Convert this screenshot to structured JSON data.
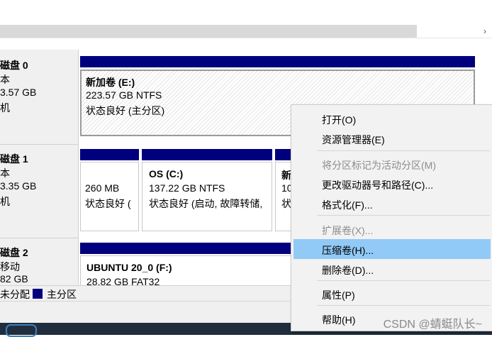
{
  "disks": [
    {
      "name": "磁盘 0",
      "type": "本",
      "size": "3.57 GB",
      "status": "机"
    },
    {
      "name": "磁盘 1",
      "type": "本",
      "size": "3.35 GB",
      "status": "机"
    },
    {
      "name": "磁盘 2",
      "type": "移动",
      "size": "82 GB"
    }
  ],
  "volumes": {
    "d0_e": {
      "title": "新加卷 (E:)",
      "size": "223.57 GB NTFS",
      "status": "状态良好 (主分区)"
    },
    "d1_p1": {
      "size": "260 MB",
      "status": "状态良好 ("
    },
    "d1_c": {
      "title": "OS  (C:)",
      "size": "137.22 GB NTFS",
      "status": "状态良好 (启动, 故障转储,"
    },
    "d1_p3": {
      "title": "新",
      "size": "10",
      "status": "状"
    },
    "d2_f": {
      "title": "UBUNTU 20_0  (F:)",
      "size": "28.82 GB FAT32"
    }
  },
  "legend": {
    "unallocated": "未分配",
    "primary": "主分区"
  },
  "context_menu": {
    "items": [
      {
        "label": "打开(O)",
        "enabled": true
      },
      {
        "label": "资源管理器(E)",
        "enabled": true
      },
      {
        "label": "将分区标记为活动分区(M)",
        "enabled": false
      },
      {
        "label": "更改驱动器号和路径(C)...",
        "enabled": true
      },
      {
        "label": "格式化(F)...",
        "enabled": true
      },
      {
        "label": "扩展卷(X)...",
        "enabled": false
      },
      {
        "label": "压缩卷(H)...",
        "enabled": true,
        "highlighted": true
      },
      {
        "label": "删除卷(D)...",
        "enabled": true
      },
      {
        "label": "属性(P)",
        "enabled": true
      },
      {
        "label": "帮助(H)",
        "enabled": true
      }
    ]
  },
  "watermark": "CSDN @蜻蜓队长~",
  "colors": {
    "primary_partition": "#00007e",
    "highlight": "#91c9f7"
  }
}
